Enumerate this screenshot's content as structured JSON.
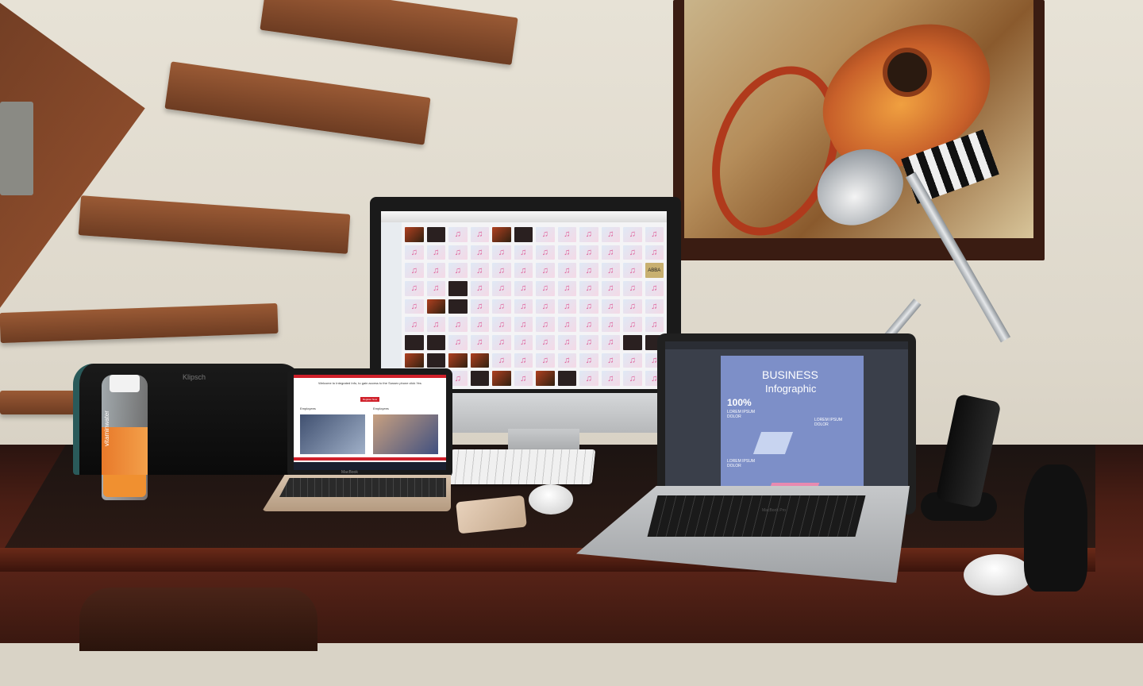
{
  "scene": {
    "description_labels": {
      "speaker_brand": "Klipsch",
      "bottle_brand": "vitaminwater"
    }
  },
  "imac_screen": {
    "tile_glyph": "♫",
    "album_label": "ABBA"
  },
  "macbook_screen": {
    "headline": "Welcome to Integrated Info, to gain access to the Sussex phone click Yes",
    "button": "Register Now",
    "caption_left": "Employees",
    "caption_right": "Employees"
  },
  "macbook_pro_screen": {
    "title_line1": "BUSINESS",
    "title_line2": "Infographic",
    "stat": "100%",
    "stat_label": "LOREM IPSUM DOLOR",
    "side_label": "LOREM IPSUM DOLOR",
    "bottom_label": "LOREM IPSUM DOLOR",
    "brand": "MacBook Pro"
  },
  "macbook_brand": "MacBook"
}
